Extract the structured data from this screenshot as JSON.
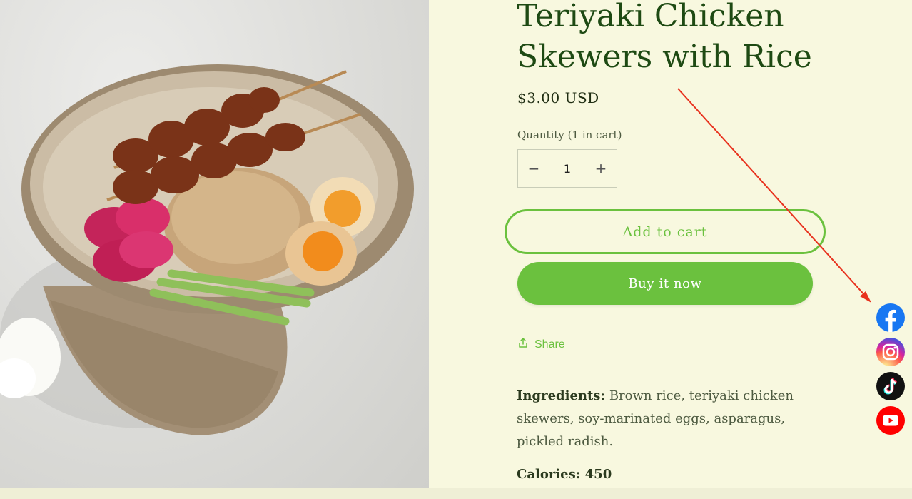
{
  "product": {
    "title": "Teriyaki Chicken Skewers with Rice",
    "price": "$3.00 USD",
    "quantity_label": "Quantity (1 in cart)",
    "quantity_value": "1",
    "minus_symbol": "−",
    "plus_symbol": "+",
    "add_to_cart_label": "Add to cart",
    "buy_now_label": "Buy it now",
    "share_label": "Share",
    "ingredients_heading": "Ingredients:",
    "ingredients_text": " Brown rice, teriyaki chicken skewers, soy-marinated eggs, asparagus, pickled radish.",
    "calories_heading": "Calories: 450"
  },
  "social": {
    "items": [
      {
        "name": "facebook-icon"
      },
      {
        "name": "instagram-icon"
      },
      {
        "name": "tiktok-icon"
      },
      {
        "name": "youtube-icon"
      }
    ]
  },
  "colors": {
    "page_background": "#f8f8df",
    "accent_green": "#6bc13e",
    "title_green": "#1e4a13",
    "annotation_arrow": "#e8321e"
  }
}
